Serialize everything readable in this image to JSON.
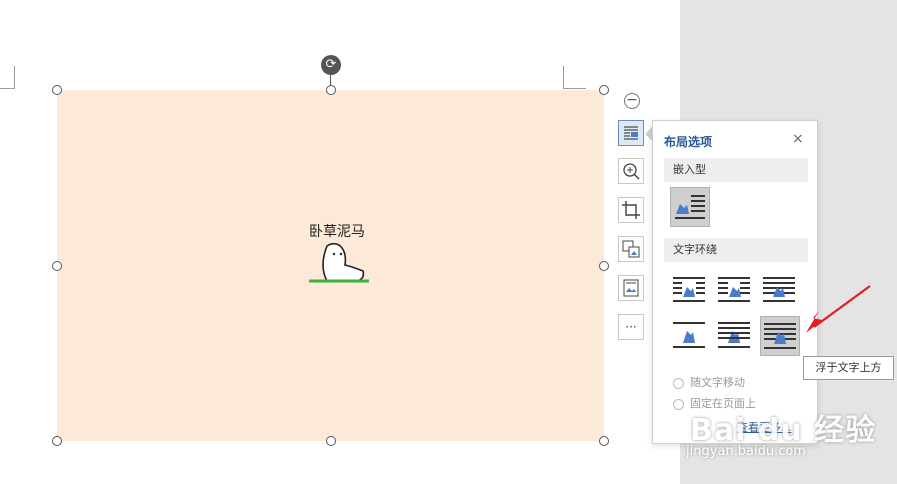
{
  "image": {
    "caption": "卧草泥马"
  },
  "layout_popup": {
    "title": "布局选项",
    "close_glyph": "×",
    "inline_section": "嵌入型",
    "wrap_section": "文字环绕",
    "move_with_text": "随文字移动",
    "fix_on_page": "固定在页面上",
    "more_link": "查看更多..."
  },
  "tooltip": {
    "text": "浮于文字上方"
  },
  "side_tools": {
    "more_glyph": "···"
  },
  "watermark": {
    "brand": "Bai du 经验",
    "url": "jingyan.baidu.com"
  },
  "colors": {
    "image_bg": "#fde9d7",
    "accent": "#2a579a",
    "arrow": "#e02020",
    "icon_blue": "#4a7ccc"
  }
}
